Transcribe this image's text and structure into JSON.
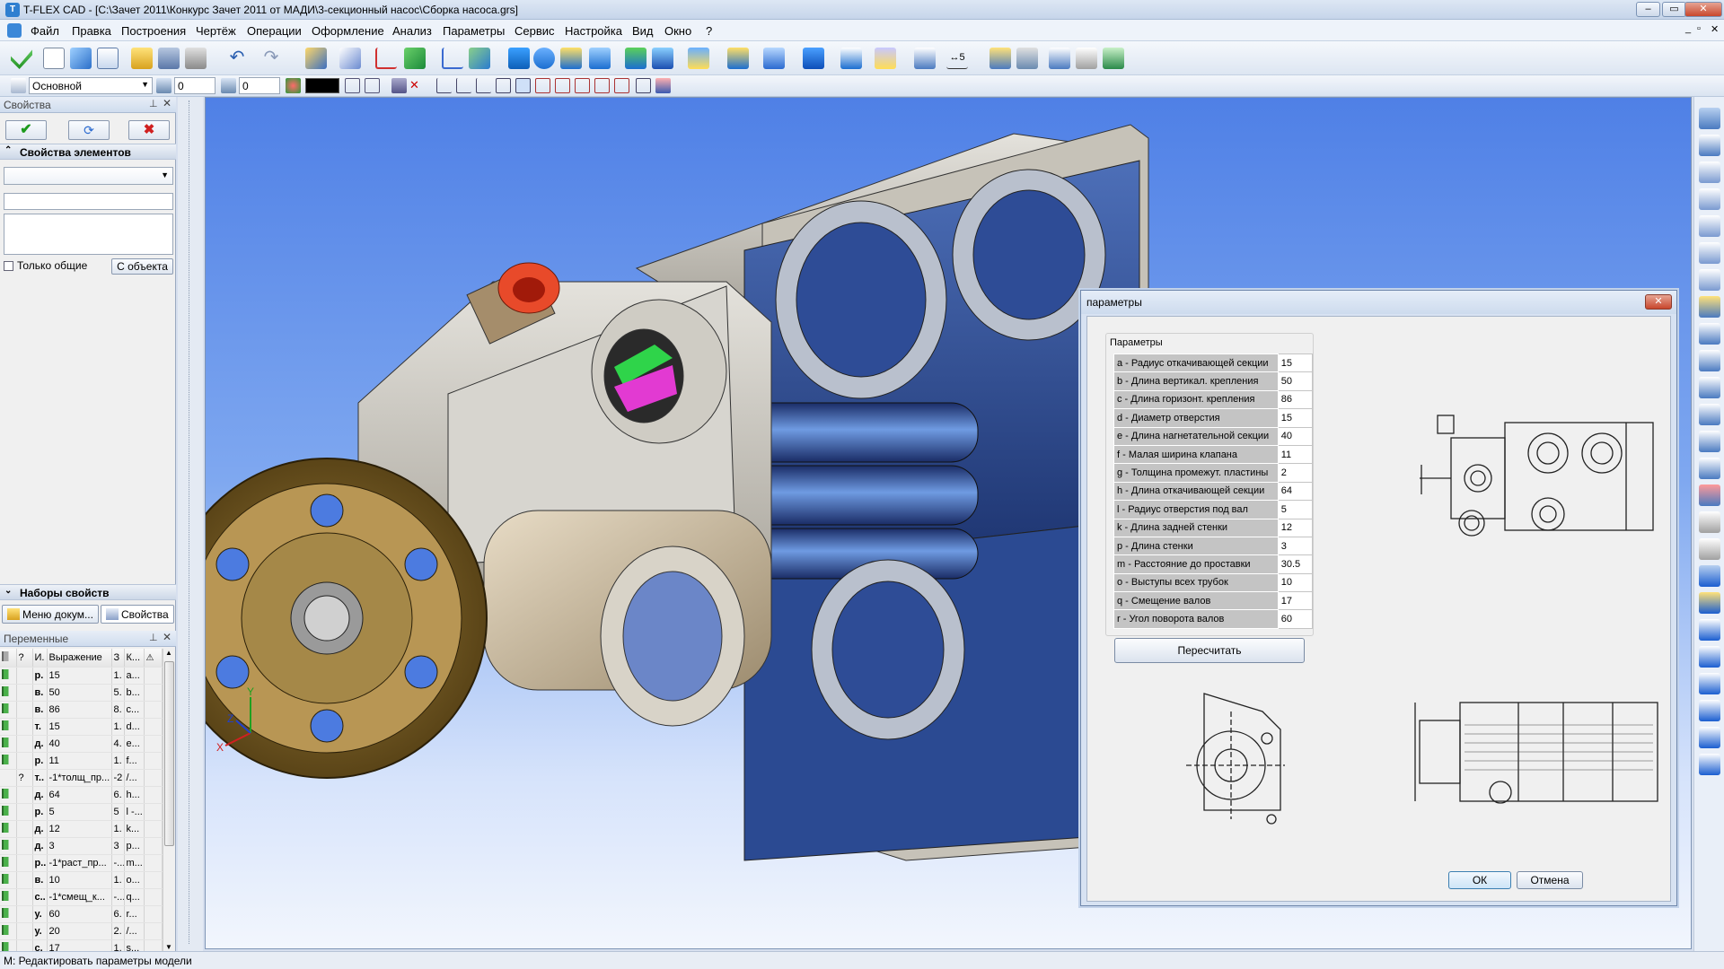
{
  "app": {
    "title": "T-FLEX CAD - [C:\\Зачет 2011\\Конкурс Зачет 2011 от МАДИ\\3-секционный насос\\Сборка насоса.grs]"
  },
  "menu": [
    "Файл",
    "Правка",
    "Построения",
    "Чертёж",
    "Операции",
    "Оформление",
    "Анализ",
    "Параметры",
    "Сервис",
    "Настройка",
    "Вид",
    "Окно",
    "?"
  ],
  "toolbar2": {
    "layer": "Основной",
    "field1": "0",
    "field2": "0"
  },
  "left_panel": {
    "properties_title": "Свойства",
    "element_props_header": "Свойства элементов",
    "only_common": "Только общие",
    "from_object": "С объекта",
    "property_sets_header": "Наборы свойств",
    "tab_doc_menu": "Меню докум...",
    "tab_properties": "Свойства",
    "variables_title": "Переменные",
    "var_columns": [
      "?",
      "И.",
      "Выражение",
      "З",
      "К..."
    ],
    "var_rows": [
      {
        "name": "p.",
        "expr": "15",
        "val": "1.",
        "k": "a..."
      },
      {
        "name": "в.",
        "expr": "50",
        "val": "5.",
        "k": "b..."
      },
      {
        "name": "в.",
        "expr": "86",
        "val": "8.",
        "k": "c..."
      },
      {
        "name": "т.",
        "expr": "15",
        "val": "1.",
        "k": "d..."
      },
      {
        "name": "д.",
        "expr": "40",
        "val": "4.",
        "k": "e..."
      },
      {
        "name": "р.",
        "expr": "11",
        "val": "1.",
        "k": "f..."
      },
      {
        "q": "?",
        "name": "т..",
        "expr": "-1*толщ_пр...",
        "val": "-2",
        "k": "/..."
      },
      {
        "name": "д.",
        "expr": "64",
        "val": "6.",
        "k": "h..."
      },
      {
        "name": "р.",
        "expr": "5",
        "val": "5",
        "k": "l -..."
      },
      {
        "name": "д.",
        "expr": "12",
        "val": "1.",
        "k": "k..."
      },
      {
        "name": "д.",
        "expr": "3",
        "val": "3",
        "k": "p..."
      },
      {
        "name": "р..",
        "expr": "-1*раст_пр...",
        "val": "-...",
        "k": "m..."
      },
      {
        "name": "в.",
        "expr": "10",
        "val": "1.",
        "k": "o..."
      },
      {
        "name": "с..",
        "expr": "-1*смещ_к...",
        "val": "-...",
        "k": "q..."
      },
      {
        "name": "у.",
        "expr": "60",
        "val": "6.",
        "k": "r..."
      },
      {
        "name": "у.",
        "expr": "20",
        "val": "2.",
        "k": "/..."
      },
      {
        "name": "с.",
        "expr": "17",
        "val": "1.",
        "k": "s..."
      }
    ]
  },
  "dialog": {
    "title": "параметры",
    "group_label": "Параметры",
    "params": [
      {
        "label": "a - Радиус откачивающей секции",
        "value": "15"
      },
      {
        "label": "b - Длина вертикал. крепления",
        "value": "50"
      },
      {
        "label": "c - Длина горизонт. крепления",
        "value": "86"
      },
      {
        "label": "d - Диаметр отверстия",
        "value": "15"
      },
      {
        "label": "e - Длина нагнетательной секции",
        "value": "40"
      },
      {
        "label": "f - Малая ширина клапана",
        "value": "11"
      },
      {
        "label": "g - Толщина промежут. пластины",
        "value": "2"
      },
      {
        "label": "h - Длина откачивающей секции",
        "value": "64"
      },
      {
        "label": "l - Радиус отверстия под вал",
        "value": "5"
      },
      {
        "label": "k - Длина задней стенки",
        "value": "12"
      },
      {
        "label": "p - Длина стенки",
        "value": "3"
      },
      {
        "label": "m - Расстояние до проставки",
        "value": "30.5"
      },
      {
        "label": "o - Выступы всех трубок",
        "value": "10"
      },
      {
        "label": "q - Смещение валов",
        "value": "17"
      },
      {
        "label": "r - Угол поворота валов",
        "value": "60"
      }
    ],
    "recalc": "Пересчитать",
    "ok": "ОК",
    "cancel": "Отмена"
  },
  "axes": {
    "x": "X",
    "y": "Y",
    "z": "Z"
  },
  "status": "М: Редактировать параметры модели"
}
